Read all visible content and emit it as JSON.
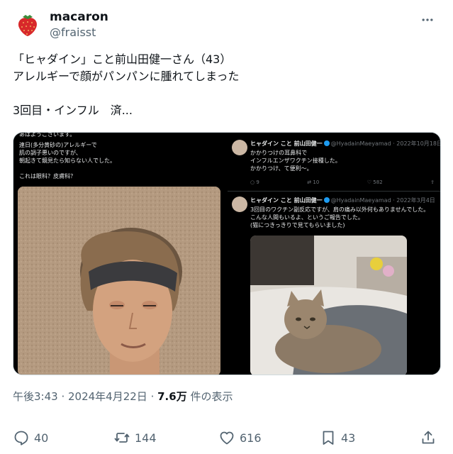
{
  "author": {
    "display_name": "macaron",
    "handle": "@fraisst"
  },
  "tweet_text": "「ヒャダイン」こと前山田健一さん（43）\nアレルギーで顔がパンパンに腫れてしまった\n\n3回目・インフル　済...",
  "left_panel": {
    "text_line1": "あはようございます。",
    "text_line2": "連日(多分黄砂の)アレルギーで",
    "text_line3": "肌の調子悪いのですが、",
    "text_line4": "朝起きて鏡見たら知らない人でした。",
    "text_line5": "これは眼科？皮膚科？"
  },
  "quote1": {
    "name": "ヒャダイン こと 前山田健一",
    "meta": "@HyadainMaeyamad · 2022年10月18日",
    "line1": "かかりつけの耳鼻科で",
    "line2": "インフルエンザワクチン接種した。",
    "line3": "かかりつけ、て便利〜。",
    "replies": "9",
    "retweets": "10",
    "likes": "582"
  },
  "quote2": {
    "name": "ヒャダイン こと 前山田健一",
    "meta": "@HyadainMaeyamad · 2022年3月4日",
    "line1": "3回目のワクチン副反応ですが、肩の痛み以外何もありませんでした。",
    "line2": "こんな人間もいるよ、というご報告でした。",
    "line3": "(猫につきっきりで見てもらいました)"
  },
  "meta": {
    "time": "午後3:43",
    "separator": " · ",
    "date": "2024年4月22日",
    "views_count": "7.6万",
    "views_label": " 件の表示"
  },
  "actions": {
    "replies": "40",
    "retweets": "144",
    "likes": "616",
    "bookmarks": "43"
  },
  "icons": [
    "strawberry-avatar",
    "more-icon",
    "reply-icon",
    "retweet-icon",
    "like-icon",
    "bookmark-icon",
    "share-icon"
  ]
}
